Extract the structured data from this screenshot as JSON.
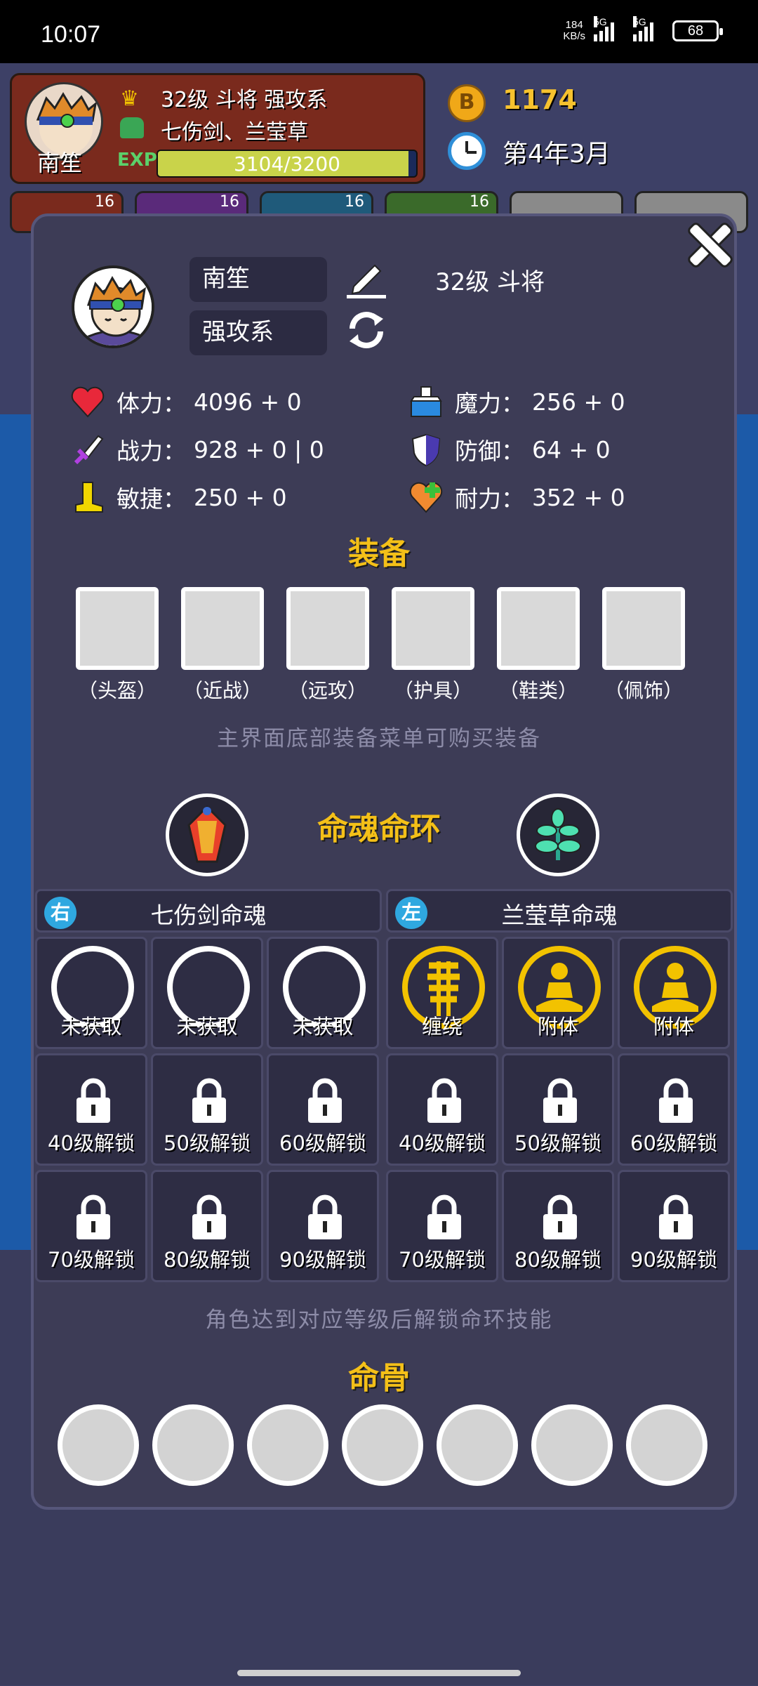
{
  "status_bar": {
    "time": "10:07",
    "net_speed_value": "184",
    "net_speed_unit": "KB/s",
    "signal_1": "5G",
    "signal_2": "5G",
    "battery": "68"
  },
  "background": {
    "player_name": "南笙",
    "level_line": "32级 斗将 强攻系",
    "souls_line": "七伤剑、兰莹草",
    "exp_label": "EXP",
    "exp_text": "3104/3200",
    "exp_progress": 0.97,
    "coin_symbol": "B",
    "coins": "1174",
    "date": "第4年3月",
    "slot_counts": [
      "16",
      "16",
      "16",
      "16"
    ]
  },
  "profile": {
    "name": "南笙",
    "class": "强攻系",
    "level_title": "32级 斗将"
  },
  "stats": [
    {
      "label": "体力：",
      "value": "4096 + 0",
      "icon": "heart-icon"
    },
    {
      "label": "魔力：",
      "value": "256 + 0",
      "icon": "potion-icon"
    },
    {
      "label": "战力：",
      "value": "928 + 0 | 0",
      "icon": "sword-icon"
    },
    {
      "label": "防御：",
      "value": "64 + 0",
      "icon": "shield-icon"
    },
    {
      "label": "敏捷：",
      "value": "250 + 0",
      "icon": "boot-icon"
    },
    {
      "label": "耐力：",
      "value": "352 + 0",
      "icon": "stamina-heart-icon"
    }
  ],
  "equipment": {
    "title": "装备",
    "slots": [
      "（头盔）",
      "（近战）",
      "（远攻）",
      "（护具）",
      "（鞋类）",
      "（佩饰）"
    ],
    "hint": "主界面底部装备菜单可购买装备"
  },
  "soul_rings": {
    "title": "命魂命环",
    "right": {
      "badge": "右",
      "title": "七伤剑命魂",
      "skills": [
        "未获取",
        "未获取",
        "未获取"
      ],
      "locked": [
        "40级解锁",
        "50级解锁",
        "60级解锁",
        "70级解锁",
        "80级解锁",
        "90级解锁"
      ]
    },
    "left": {
      "badge": "左",
      "title": "兰莹草命魂",
      "skills": [
        "缠绕",
        "附体",
        "附体"
      ],
      "locked": [
        "40级解锁",
        "50级解锁",
        "60级解锁",
        "70级解锁",
        "80级解锁",
        "90级解锁"
      ]
    },
    "hint": "角色达到对应等级后解锁命环技能"
  },
  "bones": {
    "title": "命骨",
    "count": 7
  },
  "colors": {
    "panel": "#3d3c56",
    "title_gold": "#f4c018",
    "badge_blue": "#2fa8e0",
    "skill_ring_gold": "#f2c200"
  }
}
